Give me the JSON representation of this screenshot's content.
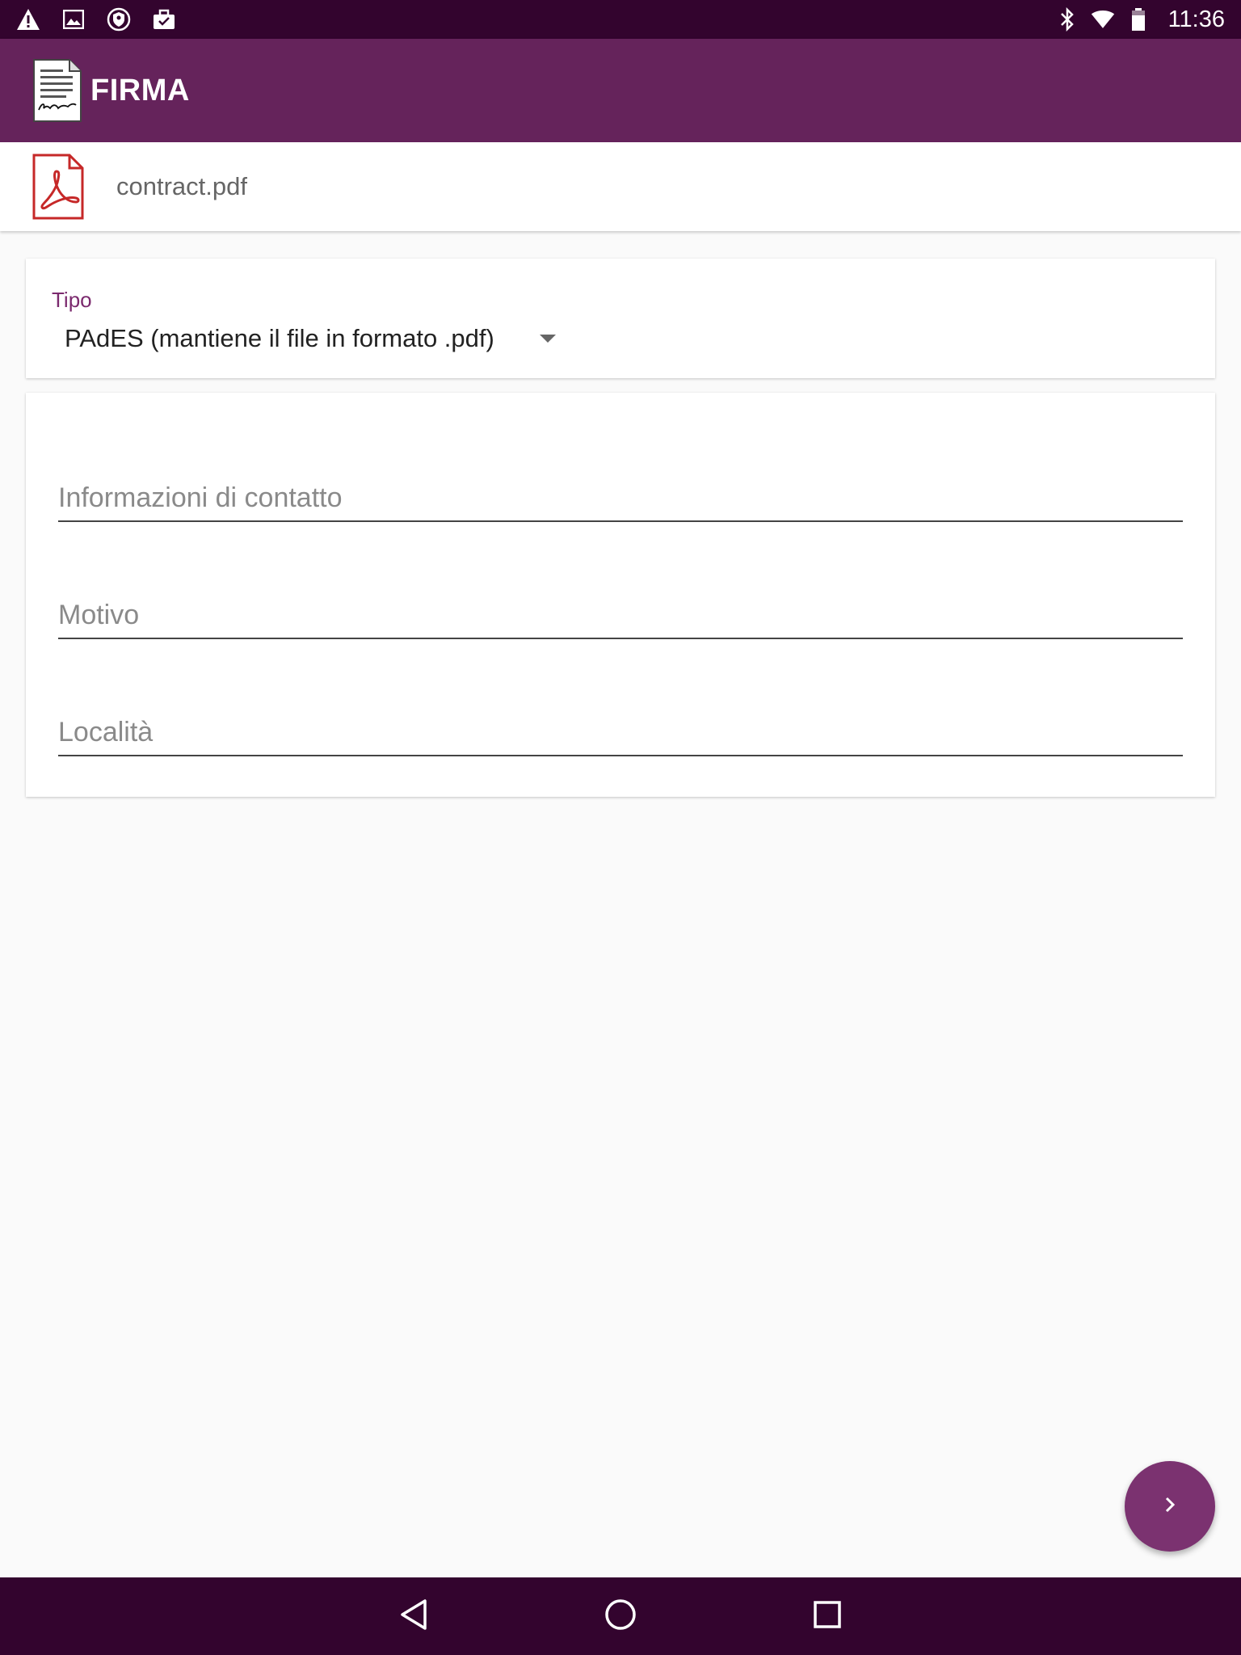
{
  "status_bar": {
    "time": "11:36",
    "left_icons": [
      "warning-icon",
      "image-icon",
      "shield-icon",
      "briefcase-icon"
    ],
    "right_icons": [
      "bluetooth-icon",
      "wifi-icon",
      "battery-icon"
    ]
  },
  "app_bar": {
    "title": "FIRMA",
    "logo_icon": "signed-document-icon"
  },
  "file": {
    "name": "contract.pdf",
    "icon": "pdf-icon",
    "icon_color": "#c62828"
  },
  "tipo": {
    "label": "Tipo",
    "selected_value": "PAdES (mantiene il file in formato .pdf)"
  },
  "fields": {
    "contact": {
      "placeholder": "Informazioni di contatto",
      "value": ""
    },
    "reason": {
      "placeholder": "Motivo",
      "value": ""
    },
    "location": {
      "placeholder": "Località",
      "value": ""
    }
  },
  "fab": {
    "icon": "chevron-right-icon"
  },
  "nav": [
    "back-icon",
    "home-icon",
    "recents-icon"
  ],
  "colors": {
    "status_bar": "#33042e",
    "app_bar": "#65235b",
    "accent": "#7b2a6e",
    "fab": "#7b3270",
    "background": "#fafafa"
  }
}
